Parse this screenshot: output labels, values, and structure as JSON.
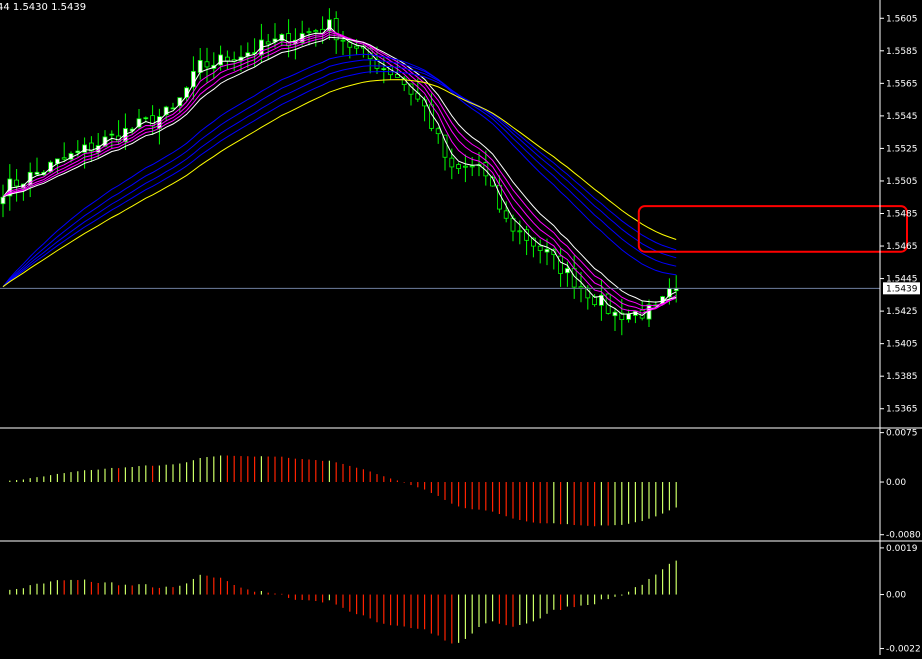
{
  "header": {
    "ohlc_text": "44 1.5430 1.5439"
  },
  "colors": {
    "background": "#000000",
    "axis": "#ffffff",
    "bull_candle": "#ffffff",
    "bear_candle": "#000000",
    "wick": "#00ff00",
    "fast_ma": "#ff00ff",
    "fast_ma_outer": "#ffffff",
    "slow_ma": "#0000ff",
    "slow_ma_outer": "#ffff00",
    "hist_up": "#ccff66",
    "hist_down": "#ff2200",
    "price_line": "#6f7fa0",
    "highlight_box": "#ff0000"
  },
  "chart_data": [
    {
      "type": "candlestick",
      "panel": "price",
      "ylim": [
        1.5355,
        1.5615
      ],
      "yticks": [
        "1.5605",
        "1.5585",
        "1.5565",
        "1.5545",
        "1.5525",
        "1.5505",
        "1.5485",
        "1.5465",
        "1.5445",
        "1.5425",
        "1.5405",
        "1.5385",
        "1.5365"
      ],
      "current_price_label": "1.5439",
      "current_price": 1.5439,
      "bars": 100,
      "highlight_box": {
        "price_top": 1.54895,
        "price_bottom": 1.54615,
        "bar_from": 93.5,
        "bar_to": 999
      }
    },
    {
      "type": "histogram",
      "panel": "oscillator1",
      "ylim": [
        -0.0085,
        0.0079
      ],
      "yticks": [
        "0.0075",
        "0.00",
        "-0.0080"
      ]
    },
    {
      "type": "histogram",
      "panel": "oscillator2",
      "ylim": [
        -0.0023,
        0.0021
      ],
      "yticks": [
        "0.0019",
        "0.00",
        "-0.0022"
      ]
    }
  ]
}
